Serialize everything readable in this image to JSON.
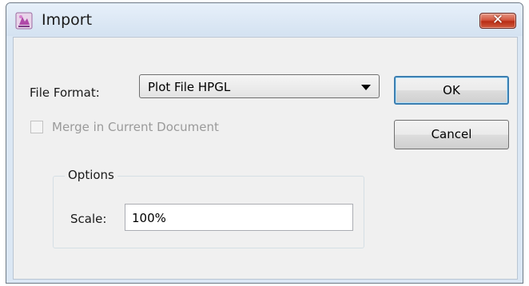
{
  "window": {
    "title": "Import",
    "close_symbol": "✕"
  },
  "form": {
    "file_format_label": "File Format:",
    "file_format_value": "Plot File HPGL",
    "merge_label": "Merge in Current Document",
    "merge_checked": false,
    "merge_enabled": false
  },
  "options": {
    "group_label": "Options",
    "scale_label": "Scale:",
    "scale_value": "100%"
  },
  "buttons": {
    "ok_label": "OK",
    "cancel_label": "Cancel"
  },
  "icons": {
    "app": "app-icon",
    "close": "close-icon",
    "dropdown": "chevron-down-icon"
  },
  "colors": {
    "title_bar": "#dbe7f4",
    "close_button": "#c94a32",
    "ok_focus_border": "#3c7fb1",
    "disabled_text": "#9a9a9a"
  }
}
